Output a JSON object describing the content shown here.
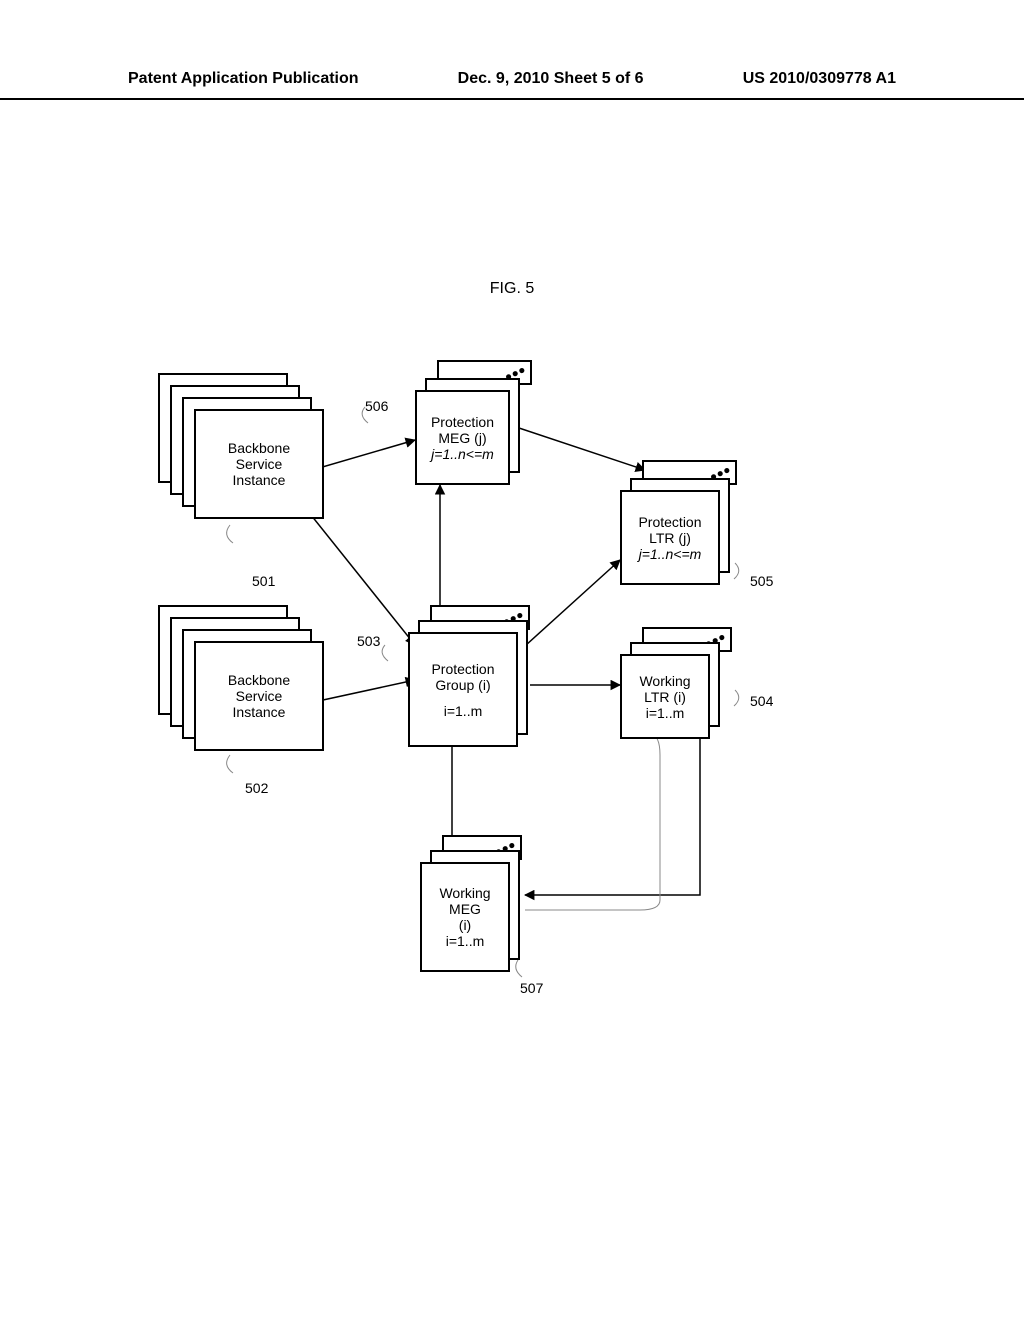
{
  "header": {
    "left": "Patent Application Publication",
    "center": "Dec. 9, 2010  Sheet 5 of 6",
    "right": "US 2010/0309778 A1"
  },
  "figure": {
    "title": "FIG. 5"
  },
  "boxes": {
    "bsi1": {
      "line1": "Backbone",
      "line2": "Service",
      "line3": "Instance"
    },
    "bsi2": {
      "line1": "Backbone",
      "line2": "Service",
      "line3": "Instance"
    },
    "pmeg": {
      "line1": "Protection",
      "line2": "MEG (j)",
      "line3": "j=1..n<=m"
    },
    "pltr": {
      "line1": "Protection",
      "line2": "LTR (j)",
      "line3": "j=1..n<=m"
    },
    "pg": {
      "line1": "Protection",
      "line2": "Group (i)",
      "line3": "i=1..m"
    },
    "wltr": {
      "line1": "Working",
      "line2": "LTR (i)",
      "line3": "i=1..m"
    },
    "wmeg": {
      "line1": "Working",
      "line2": "MEG",
      "line3": "(i)",
      "line4": "i=1..m"
    }
  },
  "labels": {
    "l501": "501",
    "l502": "502",
    "l503": "503",
    "l504": "504",
    "l505": "505",
    "l506": "506",
    "l507": "507"
  }
}
